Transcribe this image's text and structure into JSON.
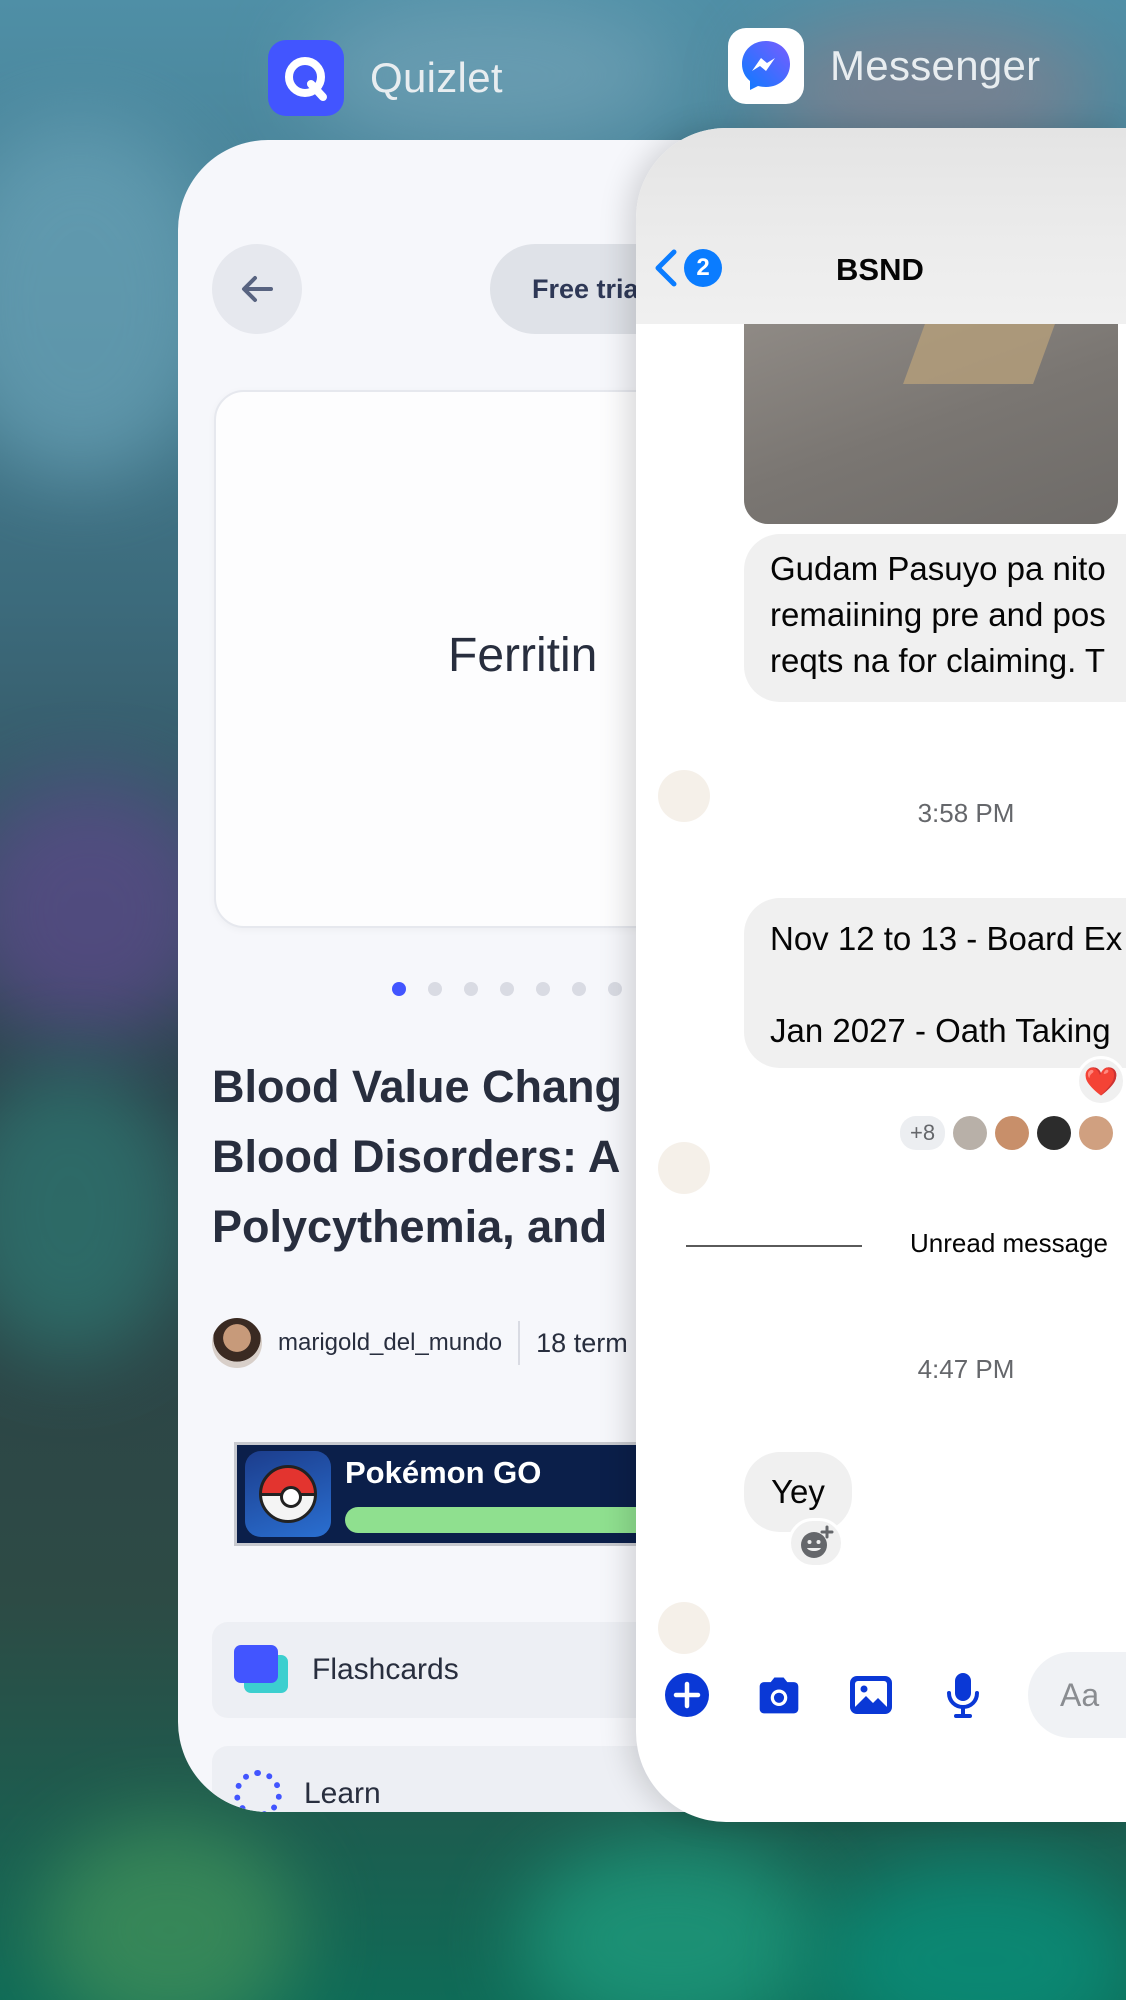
{
  "apps": {
    "quizlet": {
      "name": "Quizlet",
      "icon": "quizlet-app-icon",
      "color": "#4255ff"
    },
    "messenger": {
      "name": "Messenger",
      "icon": "messenger-app-icon",
      "color": "#0a7cff"
    }
  },
  "quizlet": {
    "free_trial": "Free tria",
    "flashcard_term": "Ferritin",
    "title": "Blood Value Chang\nBlood Disorders: A\nPolycythemia, and",
    "author": "marigold_del_mundo",
    "terms": "18 term",
    "ad": {
      "name": "Pokémon GO"
    },
    "modes": [
      {
        "label": "Flashcards",
        "icon": "flashcards-icon"
      },
      {
        "label": "Learn",
        "icon": "learn-icon"
      }
    ]
  },
  "messenger": {
    "back_badge": "2",
    "chat_title": "BSND",
    "message1": "Gudam Pasuyo pa nito\nremaiining pre and pos\nreqts na for claiming. T",
    "time1": "3:58 PM",
    "message2": "Nov 12 to 13 - Board Ex\n\nJan 2027 - Oath Taking",
    "reaction": "❤️",
    "seen_count": "+8",
    "unread_label": "Unread message",
    "time2": "4:47 PM",
    "message3": "Yey",
    "input_placeholder": "Aa"
  }
}
